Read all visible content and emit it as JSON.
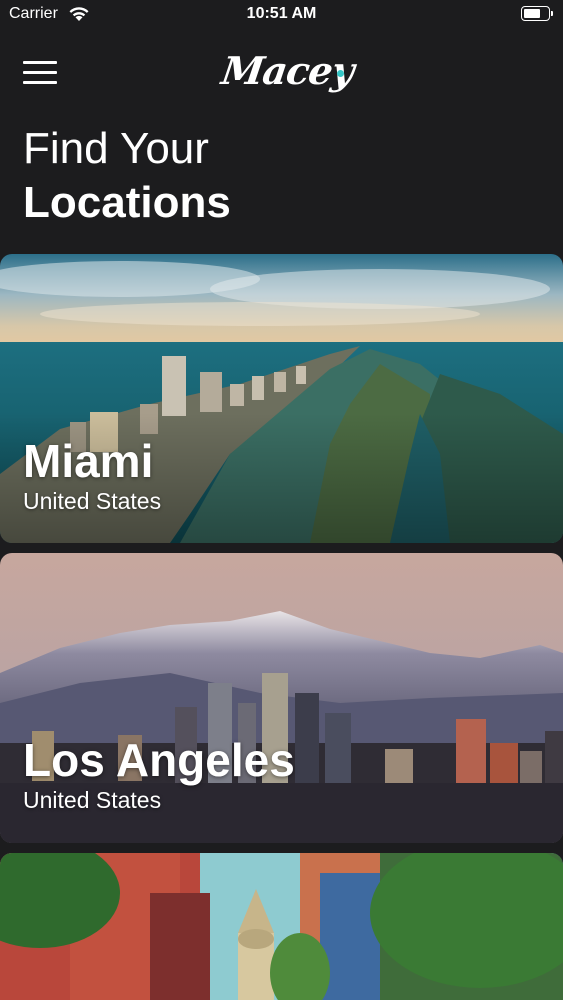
{
  "status_bar": {
    "carrier": "Carrier",
    "time": "10:51 AM"
  },
  "header": {
    "logo_text": "Macey",
    "menu_icon": "hamburger-menu-icon"
  },
  "title": {
    "line1": "Find Your",
    "line2": "Locations"
  },
  "locations": [
    {
      "name": "Miami",
      "country": "United States"
    },
    {
      "name": "Los Angeles",
      "country": "United States"
    },
    {
      "name": "",
      "country": ""
    }
  ],
  "colors": {
    "background": "#1c1c1e",
    "accent": "#35c6c6"
  }
}
